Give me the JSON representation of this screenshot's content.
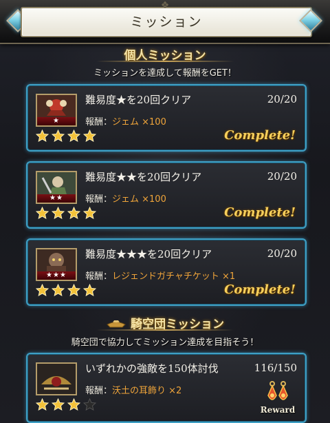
{
  "header": {
    "title": "ミッション"
  },
  "personal": {
    "heading": "個人ミッション",
    "subtitle": "ミッションを達成して報酬をGET！"
  },
  "missions": [
    {
      "title": "難易度★を20回クリア",
      "progress": "20/20",
      "reward_label": "報酬：",
      "reward_value": "ジェム ×100",
      "rank_stars": "★",
      "stars_filled": 4,
      "stars_total": 4,
      "status": "Complete!"
    },
    {
      "title": "難易度★★を20回クリア",
      "progress": "20/20",
      "reward_label": "報酬：",
      "reward_value": "ジェム ×100",
      "rank_stars": "★★",
      "stars_filled": 4,
      "stars_total": 4,
      "status": "Complete!"
    },
    {
      "title": "難易度★★★を20回クリア",
      "progress": "20/20",
      "reward_label": "報酬：",
      "reward_value": "レジェンドガチャチケット ×1",
      "rank_stars": "★★★",
      "stars_filled": 4,
      "stars_total": 4,
      "status": "Complete!"
    }
  ],
  "crew": {
    "heading": "騎空団ミッション",
    "subtitle": "騎空団で協力してミッション達成を目指そう！",
    "mission": {
      "title": "いずれかの強敵を150体討伐",
      "progress": "116/150",
      "reward_label": "報酬：",
      "reward_value": "沃土の耳飾り ×2",
      "stars_filled": 3,
      "stars_total": 4,
      "reward_button": "Reward"
    }
  },
  "colors": {
    "card_border": "#3f9fc4",
    "reward_text": "#f0a53a",
    "complete_text": "#f6cf5c",
    "star_filled": "#f3c23a",
    "star_empty": "#2a2a2a"
  }
}
